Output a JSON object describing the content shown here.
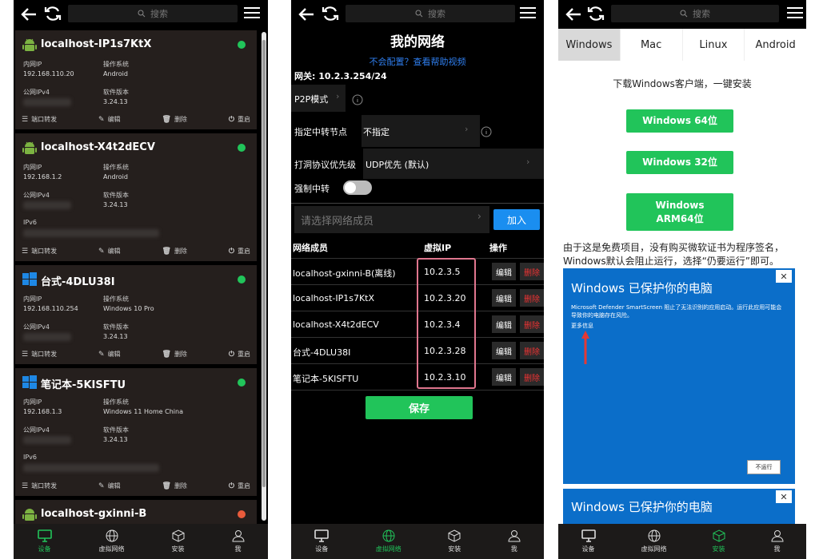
{
  "colors": {
    "accent_green": "#21c45a",
    "online": "#21c45a",
    "offline": "#e95b3b",
    "link_blue": "#2f7ff0",
    "danger": "#e33333"
  },
  "search_placeholder": "搜索",
  "panel1": {
    "cards": [
      {
        "name": "localhost-IP1s7KtX",
        "os_icon": "android-icon",
        "status": "online",
        "lan_label": "内网IP",
        "lan_ip": "192.168.110.20",
        "os_label": "操作系统",
        "os": "Android",
        "pub_label": "公网IPv4",
        "ver_label": "软件版本",
        "version": "3.24.13"
      },
      {
        "name": "localhost-X4t2dECV",
        "os_icon": "android-icon",
        "status": "online",
        "lan_label": "内网IP",
        "lan_ip": "192.168.1.2",
        "os_label": "操作系统",
        "os": "Android",
        "pub_label": "公网IPv4",
        "ver_label": "软件版本",
        "version": "3.24.13",
        "ipv6_label": "IPv6"
      },
      {
        "name": "台式-4DLU38I",
        "os_icon": "windows-icon",
        "status": "online",
        "lan_label": "内网IP",
        "lan_ip": "192.168.110.254",
        "os_label": "操作系统",
        "os": "Windows 10 Pro",
        "pub_label": "公网IPv4",
        "ver_label": "软件版本",
        "version": "3.24.13"
      },
      {
        "name": "笔记本-5KISFTU",
        "os_icon": "windows-icon",
        "status": "online",
        "lan_label": "内网IP",
        "lan_ip": "192.168.1.3",
        "os_label": "操作系统",
        "os": "Windows 11 Home China",
        "pub_label": "公网IPv4",
        "ver_label": "软件版本",
        "version": "3.24.13",
        "ipv6_label": "IPv6"
      },
      {
        "name": "localhost-gxinni-B",
        "os_icon": "android-icon",
        "status": "offline"
      }
    ],
    "actions": {
      "port_forward": "端口转发",
      "edit": "编辑",
      "delete": "删除",
      "restart": "重启"
    }
  },
  "nav": {
    "devices": "设备",
    "vnet": "虚拟网络",
    "install": "安装",
    "me": "我"
  },
  "panel2": {
    "title": "我的网络",
    "help_link": "不会配置？查看帮助视频",
    "gateway": "网关: 10.2.3.254/24",
    "p2p_label": "P2P模式",
    "relay_label": "指定中转节点",
    "relay_value": "不指定",
    "protocol_label": "打洞协议优先级",
    "protocol_value": "UDP优先 (默认)",
    "force_relay_label": "强制中转",
    "force_relay_on": false,
    "member_placeholder": "请选择网络成员",
    "join_label": "加入",
    "col_member": "网络成员",
    "col_vip": "虚拟IP",
    "col_ops": "操作",
    "members": [
      {
        "name": "localhost-gxinni-B(离线)",
        "ip": "10.2.3.5"
      },
      {
        "name": "localhost-IP1s7KtX",
        "ip": "10.2.3.20"
      },
      {
        "name": "localhost-X4t2dECV",
        "ip": "10.2.3.4"
      },
      {
        "name": "台式-4DLU38I",
        "ip": "10.2.3.28"
      },
      {
        "name": "笔记本-5KISFTU",
        "ip": "10.2.3.10"
      }
    ],
    "edit_label": "编辑",
    "delete_label": "删除",
    "save_label": "保存"
  },
  "panel3": {
    "tabs": [
      "Windows",
      "Mac",
      "Linux",
      "Android"
    ],
    "active_tab": "Windows",
    "heading": "下载Windows客户端，一键安装",
    "btn_64": "Windows 64位",
    "btn_32": "Windows 32位",
    "btn_arm_line1": "Windows",
    "btn_arm_line2": "ARM64位",
    "note": "由于这是免费项目，没有购买微软证书为程序签名，Windows默认会阻止运行，选择“仍要运行”即可。",
    "smartscreen_title": "Windows 已保护你的电脑",
    "smartscreen_text": "Microsoft Defender SmartScreen 阻止了无法识别的应用启动。运行此应用可能会导致你的电脑存在风险。",
    "more_info": "更多信息",
    "dont_run": "不运行",
    "smartscreen_title_2": "Windows 已保护你的电脑"
  }
}
